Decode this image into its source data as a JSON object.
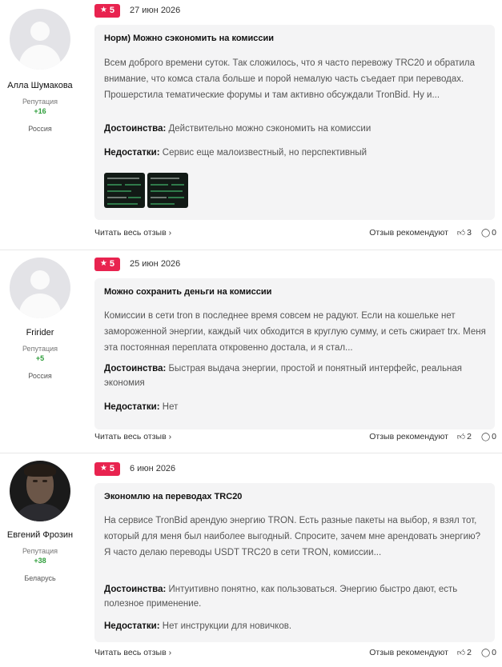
{
  "reviews": [
    {
      "author": "Алла Шумакова",
      "reputation_label": "Репутация",
      "reputation": "+16",
      "country": "Россия",
      "rating": "5",
      "date": "27 июн 2026",
      "title": "Норм) Можно сэкономить на комиссии",
      "text": "Всем доброго времени суток. Так сложилось, что я часто перевожу TRC20 и обратила внимание, что комса стала больше и порой немалую часть съедает при переводах. Прошерстила тематические форумы и там активно обсуждали TronBid. Ну и...",
      "pros_label": "Достоинства:",
      "pros": "Действительно можно сэкономить на комиссии",
      "cons_label": "Недостатки:",
      "cons": "Сервис еще малоизвестный, но перспективный",
      "read_more": "Читать весь отзыв ›",
      "recommend": "Отзыв рекомендуют",
      "likes": "3",
      "comments": "0"
    },
    {
      "author": "Fririder",
      "reputation_label": "Репутация",
      "reputation": "+5",
      "country": "Россия",
      "rating": "5",
      "date": "25 июн 2026",
      "title": "Можно сохранить деньги на комиссии",
      "text": "Комиссии в сети tron в последнее время совсем не радуют. Если на кошельке нет замороженной энергии, каждый чих обходится в круглую сумму, и сеть сжирает trx. Меня эта постоянная переплата откровенно достала, и я стал...",
      "pros_label": "Достоинства:",
      "pros": "Быстрая выдача энергии, простой и понятный интерфейс, реальная экономия",
      "cons_label": "Недостатки:",
      "cons": "Нет",
      "read_more": "Читать весь отзыв ›",
      "recommend": "Отзыв рекомендуют",
      "likes": "2",
      "comments": "0"
    },
    {
      "author": "Евгений Фрозин",
      "reputation_label": "Репутация",
      "reputation": "+38",
      "country": "Беларусь",
      "rating": "5",
      "date": "6 июн 2026",
      "title": "Экономлю на переводах TRC20",
      "text": "На сервисе TronBid арендую энергию TRON. Есть разные пакеты на выбор, я взял тот, который для меня был наиболее выгодный. Спросите, зачем мне арендовать энергию? Я часто делаю переводы USDT TRC20 в сети TRON, комиссии...",
      "pros_label": "Достоинства:",
      "pros": "Интуитивно понятно, как пользоваться. Энергию быстро дают, есть полезное применение.",
      "cons_label": "Недостатки:",
      "cons": "Нет инструкции для новичков.",
      "read_more": "Читать весь отзыв ›",
      "recommend": "Отзыв рекомендуют",
      "likes": "2",
      "comments": "0"
    }
  ],
  "icons": {
    "star": "star-icon",
    "like": "thumbs-up-icon",
    "comment": "comment-icon",
    "avatar_placeholder": "user-placeholder-icon"
  },
  "colors": {
    "badge": "#e8234f",
    "reputation": "#2e9e3b",
    "card_bg": "#f4f4f5"
  }
}
